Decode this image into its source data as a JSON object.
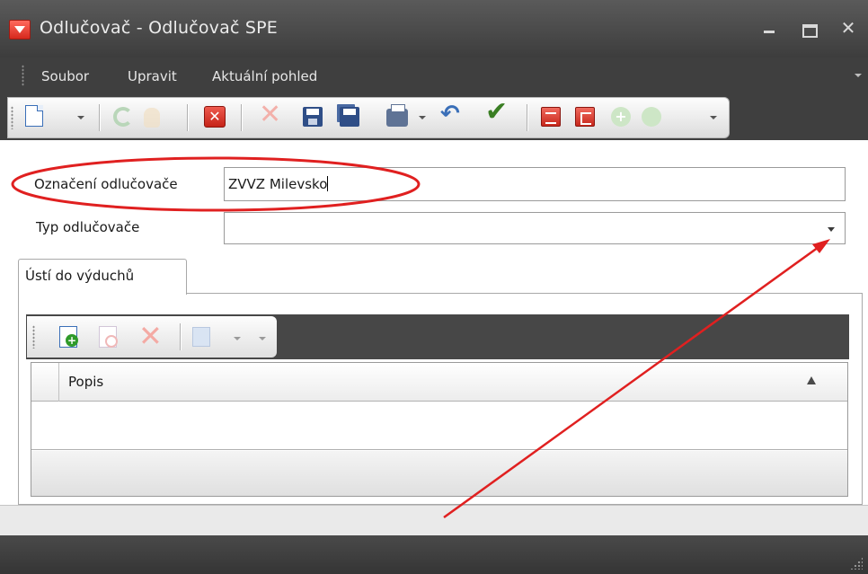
{
  "window": {
    "title": "Odlučovač  - Odlučovač SPE",
    "close_glyph": "✕"
  },
  "menu": {
    "items": [
      {
        "label": "Soubor"
      },
      {
        "label": "Upravit"
      },
      {
        "label": "Aktuální pohled"
      }
    ]
  },
  "toolbar": {
    "icons": [
      "new-document-icon",
      "refresh-icon",
      "hand-icon",
      "delete-red-icon",
      "cancel-x-icon",
      "save-icon",
      "save-as-icon",
      "print-icon",
      "undo-icon",
      "checkmark-icon",
      "red-book-icon",
      "red-book-exit-icon",
      "green-plus-icon",
      "green-down-icon"
    ],
    "undo_glyph": "↶",
    "check_glyph": "✔",
    "x_glyph": "✕",
    "delete_glyph": "✕",
    "plus_glyph": "+"
  },
  "form": {
    "oznaceni_label": "Označení odlučovače",
    "oznaceni_value": "ZVVZ Milevsko",
    "typ_label": "Typ odlučovače",
    "typ_value": ""
  },
  "tabs": [
    {
      "label": "Ústí do výduchů",
      "active": true
    }
  ],
  "grid": {
    "toolbar_icons": [
      "add-record-icon",
      "edit-record-icon",
      "delete-record-icon",
      "copy-record-icon"
    ],
    "delete_glyph": "✕",
    "columns": [
      {
        "label": "Popis",
        "sort": "ascending"
      }
    ],
    "rows": []
  },
  "annotations": {
    "highlight_color": "#e02020",
    "arrow_color": "#e02020"
  }
}
